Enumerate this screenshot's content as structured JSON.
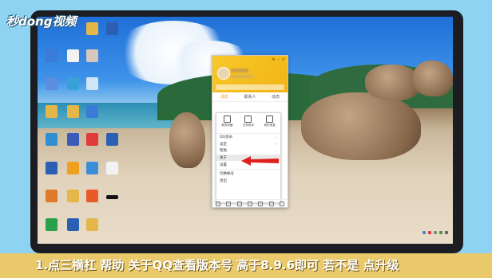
{
  "watermark": {
    "logo_text": "秒dong视频"
  },
  "qq": {
    "window_controls": [
      "⊕",
      "–",
      "×"
    ],
    "tabs": [
      {
        "label": "消息"
      },
      {
        "label": "联系人"
      },
      {
        "label": "动态"
      }
    ],
    "menu": {
      "icon_items": [
        {
          "label": "我的收藏",
          "icon": "bookmark-icon"
        },
        {
          "label": "文件助手",
          "icon": "folder-icon"
        },
        {
          "label": "我的消息",
          "icon": "message-icon"
        }
      ],
      "items": [
        {
          "label": "QQ会员",
          "submenu": true
        },
        {
          "label": "设定",
          "submenu": true
        },
        {
          "label": "帮助",
          "submenu": true
        },
        {
          "label": "关于",
          "submenu": false,
          "highlighted": true
        },
        {
          "label": "设置",
          "submenu": false
        }
      ],
      "bottom_items": [
        {
          "label": "切换帐号"
        },
        {
          "label": "退出"
        }
      ]
    }
  },
  "caption": {
    "text": "1.点三横杠  帮助  关于QQ查看版本号  高于8.9.6即可  若不是  点升级"
  },
  "colors": {
    "qq_yellow": "#f2b316",
    "arrow_red": "#e0201a",
    "caption_bg": "#e9c96a"
  }
}
